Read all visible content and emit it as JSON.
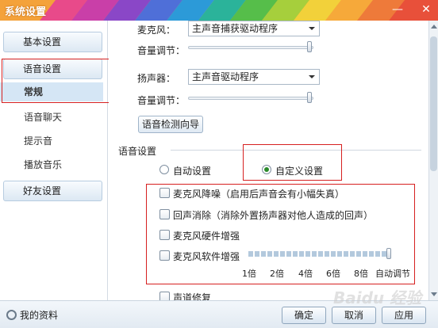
{
  "window": {
    "title": "系统设置"
  },
  "sidebar": {
    "basic": "基本设置",
    "voice": "语音设置",
    "items": [
      "常规",
      "语音聊天",
      "提示音",
      "播放音乐"
    ],
    "friends": "好友设置"
  },
  "mic": {
    "label": "麦克风：",
    "value": "主声音捕获驱动程序",
    "volume_label": "音量调节：",
    "volume_level": 1.0
  },
  "speaker": {
    "label": "扬声器：",
    "value": "主声音驱动程序",
    "volume_label": "音量调节：",
    "volume_level": 1.0
  },
  "test_button": "语音检测向导",
  "voice_section": {
    "title": "语音设置",
    "auto": "自动设置",
    "custom": "自定义设置",
    "selected": "custom"
  },
  "options": [
    "麦克风降噪（启用后声音会有小幅失真）",
    "回声消除（消除外置扬声器对他人造成的回声）",
    "麦克风硬件增强",
    "麦克风软件增强"
  ],
  "gain_ticks": [
    "1倍",
    "2倍",
    "4倍",
    "6倍",
    "8倍",
    "自动调节"
  ],
  "gain_level": "自动调节",
  "cut_item": "声道修复",
  "footer": {
    "profile": "我的资料",
    "ok": "确定",
    "cancel": "取消",
    "apply": "应用"
  },
  "watermark": "Baidu 经验",
  "colors": {
    "accent": "#d62020",
    "title_bg": "#f4a23a"
  }
}
